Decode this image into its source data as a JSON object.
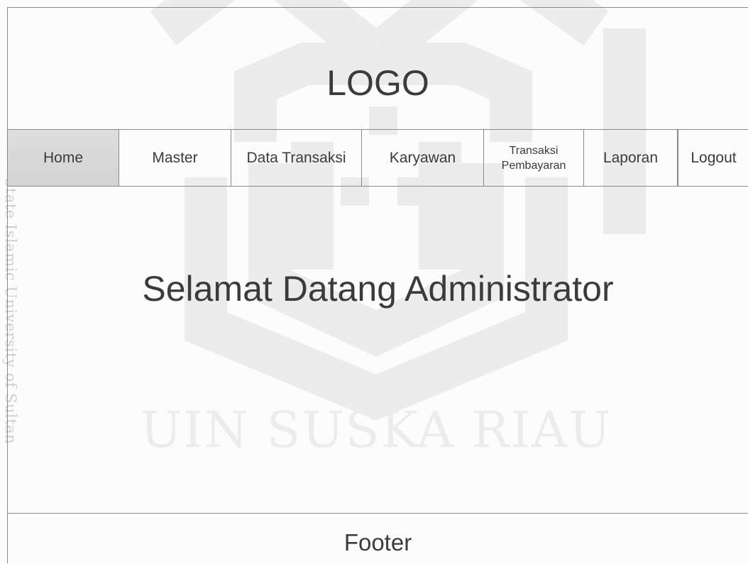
{
  "header": {
    "logo_text": "LOGO"
  },
  "nav": {
    "items": [
      {
        "label": "Home",
        "active": true
      },
      {
        "label": "Master"
      },
      {
        "label": "Data Transaksi"
      },
      {
        "label": "Karyawan"
      },
      {
        "label_line1": "Transaksi",
        "label_line2": "Pembayaran"
      },
      {
        "label": "Laporan"
      },
      {
        "label": "Logout"
      }
    ]
  },
  "main": {
    "welcome_text": "Selamat Datang Administrator"
  },
  "footer": {
    "text": "Footer"
  },
  "watermark": {
    "side_text": "State Islamic University of Sultan",
    "institution_text": "UIN SUSKA RIAU"
  },
  "colors": {
    "border": "#8a8a8a",
    "active_nav": "#d6d6d6",
    "text": "#3b3b3b",
    "watermark": "#e6e6e6"
  }
}
